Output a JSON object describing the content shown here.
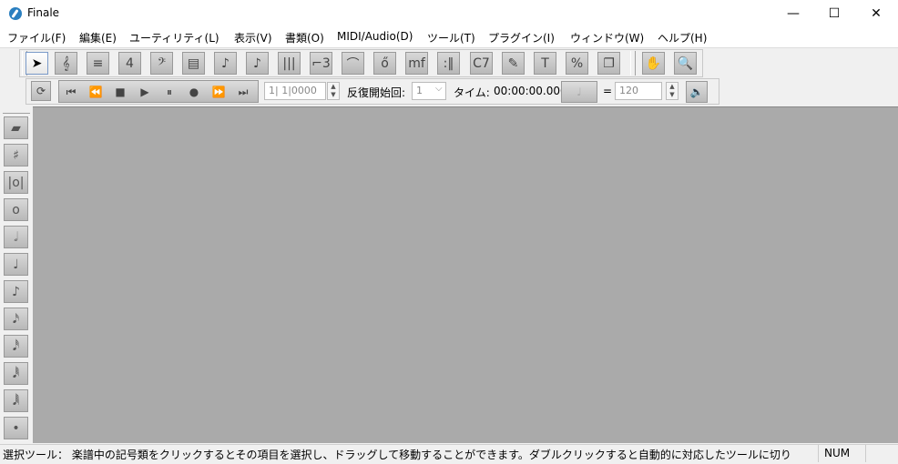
{
  "window": {
    "title": "Finale",
    "minimize": "—",
    "maximize": "☐",
    "close": "✕"
  },
  "menu": [
    {
      "label": "ファイル(F)",
      "key": "file"
    },
    {
      "label": "編集(E)",
      "key": "edit"
    },
    {
      "label": "ユーティリティ(L)",
      "key": "utilities"
    },
    {
      "label": "表示(V)",
      "key": "view"
    },
    {
      "label": "書類(O)",
      "key": "document"
    },
    {
      "label": "MIDI/Audio(D)",
      "key": "midi-audio"
    },
    {
      "label": "ツール(T)",
      "key": "tools"
    },
    {
      "label": "プラグイン(I)",
      "key": "plugins"
    },
    {
      "label": "ウィンドウ(W)",
      "key": "window"
    },
    {
      "label": "ヘルプ(H)",
      "key": "help"
    }
  ],
  "main_tools": [
    {
      "icon": "selection-arrow-icon",
      "glyph": "➤"
    },
    {
      "icon": "treble-clef-icon",
      "glyph": "𝄞"
    },
    {
      "icon": "staff-icon",
      "glyph": "≡"
    },
    {
      "icon": "time-signature-icon",
      "glyph": "4"
    },
    {
      "icon": "bass-clef-icon",
      "glyph": "𝄢"
    },
    {
      "icon": "measure-icon",
      "glyph": "▤"
    },
    {
      "icon": "simple-entry-icon",
      "glyph": "♪"
    },
    {
      "icon": "speedy-entry-icon",
      "glyph": "♪"
    },
    {
      "icon": "hyperscribe-icon",
      "glyph": "|||"
    },
    {
      "icon": "tuplet-icon",
      "glyph": "⌐3"
    },
    {
      "icon": "smart-shape-icon",
      "glyph": "⌒"
    },
    {
      "icon": "articulation-icon",
      "glyph": "ő"
    },
    {
      "icon": "expression-icon",
      "glyph": "mf"
    },
    {
      "icon": "repeat-icon",
      "glyph": ":‖"
    },
    {
      "icon": "chord-icon",
      "glyph": "C7"
    },
    {
      "icon": "lyrics-icon",
      "glyph": "✎"
    },
    {
      "icon": "text-icon",
      "glyph": "T"
    },
    {
      "icon": "mass-edit-icon",
      "glyph": "%"
    },
    {
      "icon": "page-layout-icon",
      "glyph": "❐"
    },
    {
      "icon": "hand-grabber-icon",
      "glyph": "✋"
    },
    {
      "icon": "zoom-icon",
      "glyph": "🔍"
    }
  ],
  "playback": {
    "loop_glyph": "⟳",
    "transport": [
      {
        "icon": "rewind-start-icon",
        "glyph": "⏮"
      },
      {
        "icon": "rewind-icon",
        "glyph": "⏪"
      },
      {
        "icon": "stop-icon",
        "glyph": "■"
      },
      {
        "icon": "play-icon",
        "glyph": "▶"
      },
      {
        "icon": "pause-icon",
        "glyph": "⏸"
      },
      {
        "icon": "record-icon",
        "glyph": "●"
      },
      {
        "icon": "fast-forward-icon",
        "glyph": "⏩"
      },
      {
        "icon": "forward-end-icon",
        "glyph": "⏭"
      }
    ],
    "counter_value": "1| 1|0000",
    "repeat_label": "反復開始回:",
    "repeat_value": "1",
    "time_label": "タイム:",
    "time_value": "00:00:00.000",
    "tempo_note_glyph": "♩",
    "equals": "=",
    "tempo_value": "120",
    "speaker_glyph": "🔈"
  },
  "left_palette": [
    {
      "icon": "eraser-icon",
      "glyph": "▰"
    },
    {
      "icon": "half-step-icon",
      "glyph": "♯"
    },
    {
      "icon": "breve-icon",
      "glyph": "|o|"
    },
    {
      "icon": "whole-note-icon",
      "glyph": "o"
    },
    {
      "icon": "half-note-icon",
      "glyph": "𝅗𝅥"
    },
    {
      "icon": "quarter-note-icon",
      "glyph": "♩"
    },
    {
      "icon": "eighth-note-icon",
      "glyph": "♪"
    },
    {
      "icon": "sixteenth-note-icon",
      "glyph": "𝅘𝅥𝅯"
    },
    {
      "icon": "thirty-second-note-icon",
      "glyph": "𝅘𝅥𝅰"
    },
    {
      "icon": "sixty-fourth-note-icon",
      "glyph": "𝅘𝅥𝅱"
    },
    {
      "icon": "hundred-twenty-eighth-note-icon",
      "glyph": "𝅘𝅥𝅲"
    },
    {
      "icon": "dot-icon",
      "glyph": "•"
    }
  ],
  "status": {
    "text": "選択ツール： 楽譜中の記号類をクリックするとその項目を選択し、ドラッグして移動することができます。ダブルクリックすると自動的に対応したツールに切り",
    "num": "NUM"
  }
}
